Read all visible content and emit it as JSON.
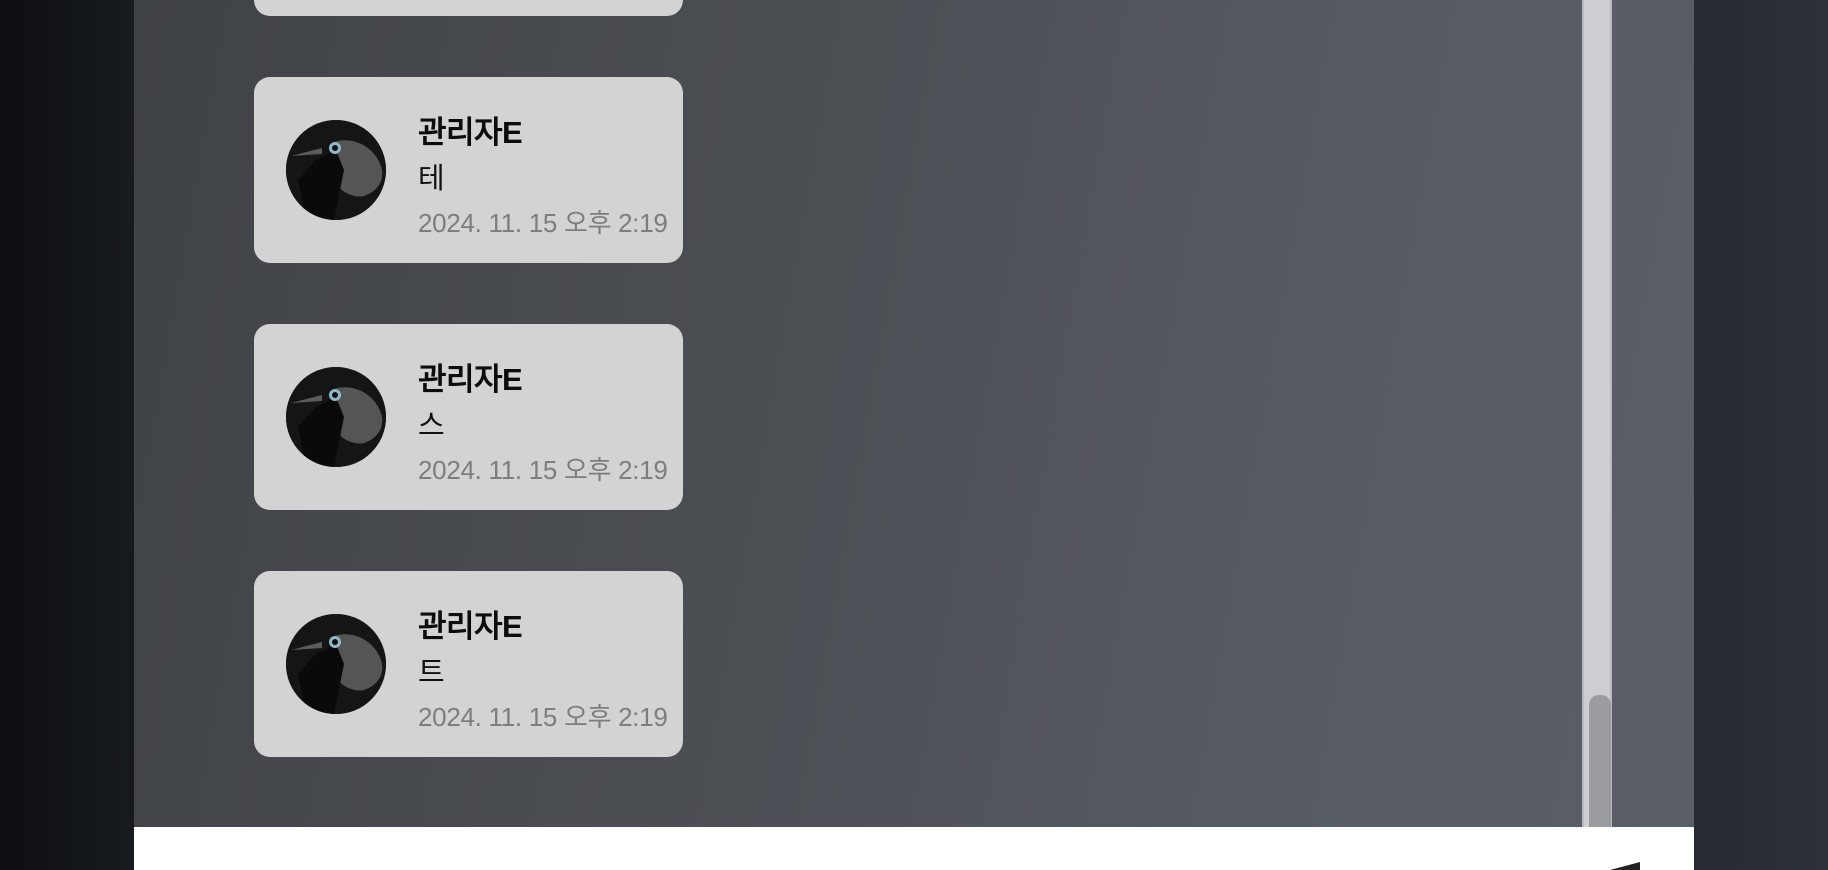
{
  "messages": [
    {
      "author": "",
      "text": "",
      "time": ""
    },
    {
      "author": "관리자E",
      "text": "테",
      "time": "2024. 11. 15 오후 2:19"
    },
    {
      "author": "관리자E",
      "text": "스",
      "time": "2024. 11. 15 오후 2:19"
    },
    {
      "author": "관리자E",
      "text": "트",
      "time": "2024. 11. 15 오후 2:19"
    }
  ],
  "avatar_icon": "magpie-bird-icon",
  "send_icon": "send-icon",
  "colors": {
    "card_bg": "#d3d3d3",
    "panel_bg": "#4b4e53",
    "time_text": "#7d7d7d",
    "input_bg": "#ffffff"
  }
}
